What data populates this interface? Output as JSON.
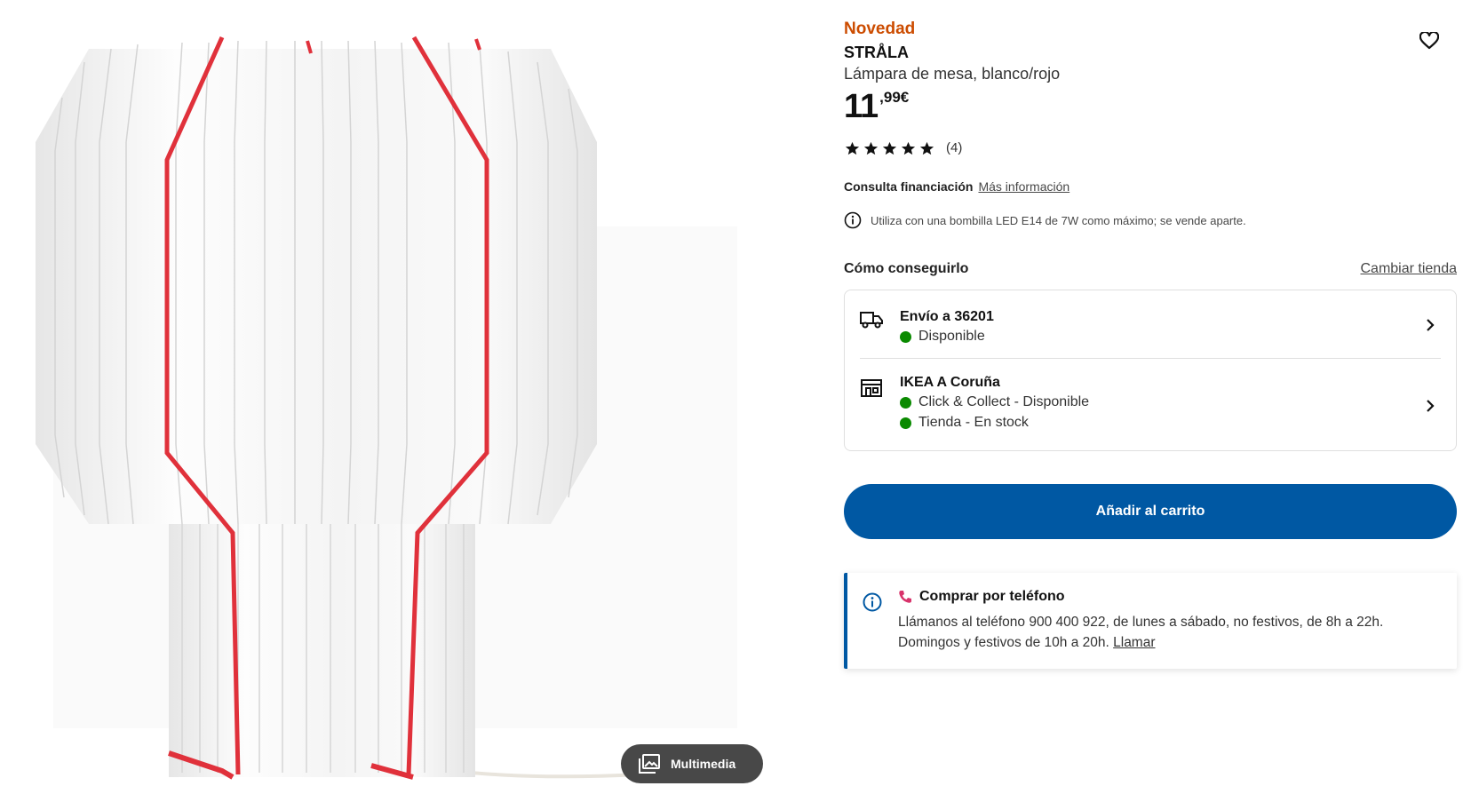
{
  "product": {
    "badge": "Novedad",
    "name": "STRÅLA",
    "description": "Lámpara de mesa, blanco/rojo",
    "price_integer": "11",
    "price_decimal": ",99€",
    "rating_count": "(4)",
    "rating_value": 5
  },
  "media": {
    "multimedia_label": "Multimedia"
  },
  "financing": {
    "label": "Consulta financiación",
    "link": "Más información"
  },
  "note": "Utiliza con una bombilla LED E14 de 7W como máximo; se vende aparte.",
  "availability": {
    "title": "Cómo conseguirlo",
    "change_store": "Cambiar tienda",
    "delivery": {
      "title": "Envío a 36201",
      "status": "Disponible"
    },
    "store": {
      "title": "IKEA A Coruña",
      "click_collect": "Click & Collect - Disponible",
      "in_store": "Tienda - En stock"
    }
  },
  "cart_button": "Añadir al carrito",
  "phone": {
    "title": "Comprar por teléfono",
    "text": "Llámanos al teléfono 900 400 922, de lunes a sábado, no festivos, de 8h a 22h. Domingos y festivos de 10h a 20h.",
    "link": "Llamar"
  },
  "colors": {
    "badge": "#cc4c00",
    "primary": "#0058a3",
    "available": "#0a8a00",
    "lamp_accent": "#e0313b"
  }
}
